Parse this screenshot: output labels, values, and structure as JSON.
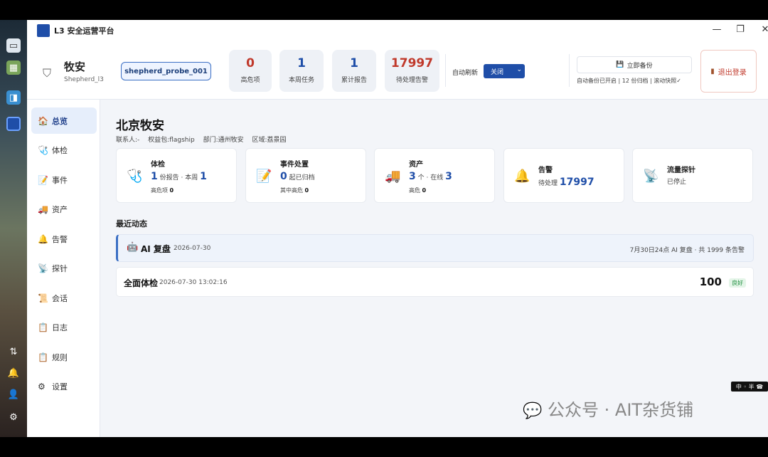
{
  "app": {
    "title": "L3 安全运营平台"
  },
  "header": {
    "org_name": "牧安",
    "org_sub": "Shepherd_l3",
    "probe": "shepherd_probe_001",
    "stats": [
      {
        "value": "0",
        "label": "高危项",
        "color": "#c0392b"
      },
      {
        "value": "1",
        "label": "本周任务",
        "color": "#1f4ea8"
      },
      {
        "value": "1",
        "label": "累计报告",
        "color": "#1f4ea8"
      },
      {
        "value": "17997",
        "label": "待处理告警",
        "color": "#c0392b"
      }
    ],
    "auto_refresh_label": "自动刷新",
    "auto_refresh_value": "关闭",
    "backup_button": "立即备份",
    "backup_info": "自动备份已开启 | 12 份归档 | 滚动快照✓",
    "logout": "退出登录"
  },
  "sidebar": {
    "items": [
      {
        "icon": "home-icon",
        "glyph": "🏠",
        "label": "总览"
      },
      {
        "icon": "stethoscope-icon",
        "glyph": "🩺",
        "label": "体检"
      },
      {
        "icon": "memo-icon",
        "glyph": "📝",
        "label": "事件"
      },
      {
        "icon": "truck-icon",
        "glyph": "🚚",
        "label": "资产"
      },
      {
        "icon": "bell-icon",
        "glyph": "🔔",
        "label": "告警"
      },
      {
        "icon": "satellite-icon",
        "glyph": "📡",
        "label": "探针"
      },
      {
        "icon": "scroll-icon",
        "glyph": "📜",
        "label": "会话"
      },
      {
        "icon": "clipboard-icon",
        "glyph": "📋",
        "label": "日志"
      },
      {
        "icon": "clipboard-rules-icon",
        "glyph": "📋",
        "label": "规则"
      },
      {
        "icon": "gear-icon",
        "glyph": "⚙",
        "label": "设置"
      }
    ]
  },
  "main": {
    "org_title": "北京牧安",
    "meta": {
      "contact": "联系人:-",
      "plan": "权益包:flagship",
      "dept": "部门:通州牧安",
      "region": "区域:荔景园"
    },
    "cards": [
      {
        "icon": "stethoscope-icon",
        "glyph": "🩺",
        "title": "体检",
        "num": "1",
        "text": "份报告 · 本周",
        "num2": "1",
        "sub_label": "高危项",
        "sub_value": "0"
      },
      {
        "icon": "memo-icon",
        "glyph": "📝",
        "title": "事件处置",
        "num": "0",
        "text": "起已归档",
        "num2": "",
        "sub_label": "其中高危",
        "sub_value": "0"
      },
      {
        "icon": "truck-icon",
        "glyph": "🚚",
        "title": "资产",
        "num": "3",
        "text": "个 · 在线",
        "num2": "3",
        "sub_label": "高危",
        "sub_value": "0"
      },
      {
        "icon": "bell-icon",
        "glyph": "🔔",
        "title": "告警",
        "num": "",
        "text": "待处理",
        "num2": "17997",
        "sub_label": "",
        "sub_value": ""
      },
      {
        "icon": "satellite-icon",
        "glyph": "📡",
        "title": "流量探针",
        "num": "",
        "text": "已停止",
        "num2": "",
        "sub_label": "",
        "sub_value": ""
      }
    ],
    "section_title": "最近动态",
    "feed": [
      {
        "title": "AI 复盘",
        "date": "2026-07-30",
        "right": "7月30日24点 AI 复盘 · 共 1999 条告警"
      },
      {
        "title": "全面体检",
        "date": "2026-07-30 13:02:16",
        "score": "100",
        "badge": "良好"
      }
    ]
  },
  "overlay": {
    "watermark": "公众号 · AIT杂货铺",
    "corner_badge": "中 ◦ 半 ☎"
  }
}
